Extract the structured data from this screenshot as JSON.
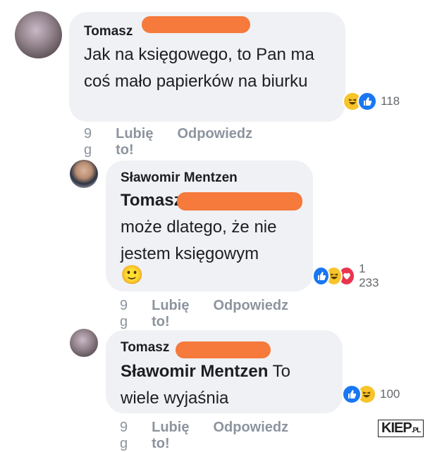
{
  "comments": [
    {
      "author": "Tomasz",
      "text": "Jak na księgowego, to Pan ma coś mało papierków na biurku",
      "reaction_count": "118",
      "time": "9 g",
      "like_label": "Lubię to!",
      "reply_label": "Odpowiedz"
    },
    {
      "author": "Sławomir Mentzen",
      "mention": "Tomasz",
      "text": "może dlatego, że nie jestem księgowym",
      "emoji": "🙂",
      "reaction_count": "1 233",
      "time": "9 g",
      "like_label": "Lubię to!",
      "reply_label": "Odpowiedz"
    },
    {
      "author": "Tomasz",
      "mention": "Sławomir Mentzen",
      "text": "To wiele wyjaśnia",
      "reaction_count": "100",
      "time": "9 g",
      "like_label": "Lubię to!",
      "reply_label": "Odpowiedz"
    }
  ],
  "colors": {
    "bubble": "#eff1f4",
    "redaction": "#f57a3c",
    "like": "#1877f2",
    "haha": "#f7c42b",
    "love": "#e8354e"
  },
  "watermark": {
    "brand": "KIEP",
    "suffix": ".PL"
  }
}
